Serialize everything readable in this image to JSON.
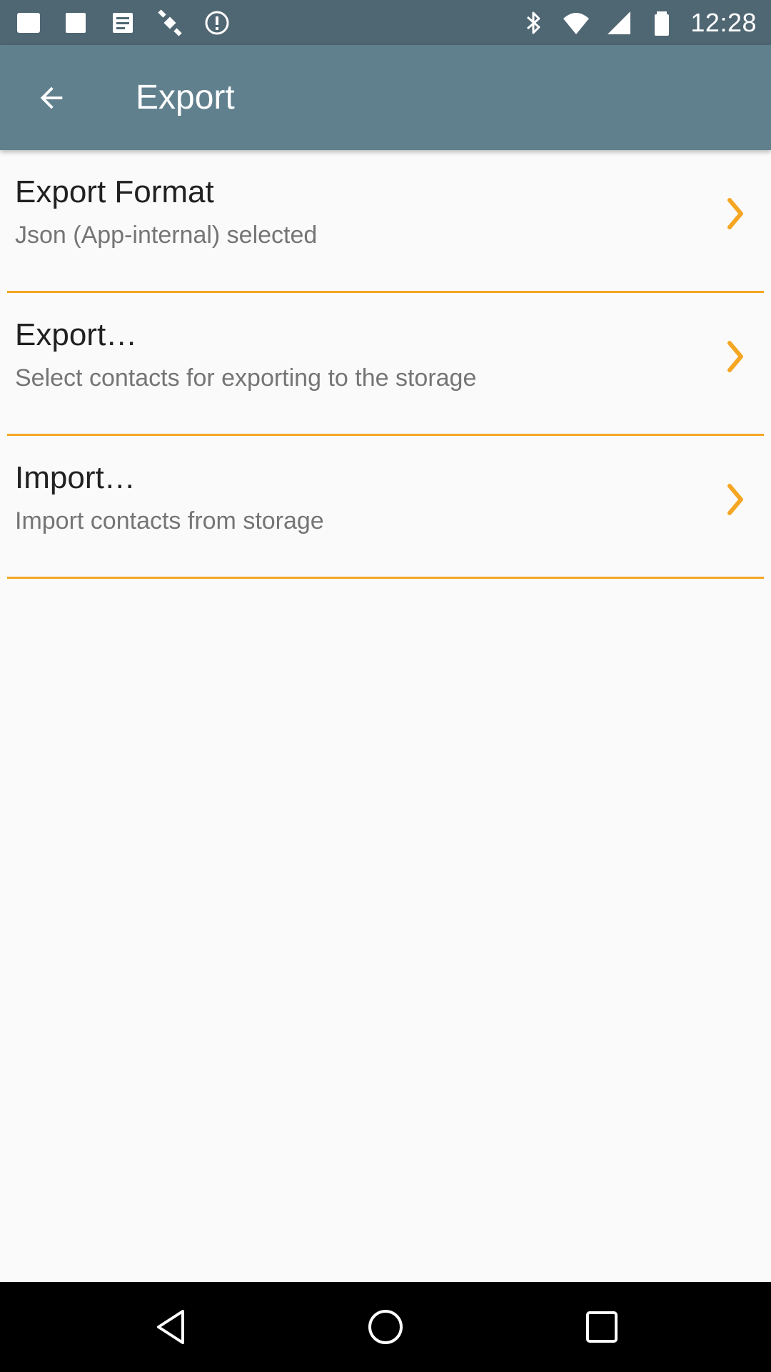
{
  "status_bar": {
    "time": "12:28",
    "left_icons": [
      "grid-icon",
      "tile-icon",
      "text-tile-icon",
      "satellite-icon",
      "alert-icon"
    ],
    "right_icons": [
      "bluetooth-icon",
      "wifi-icon",
      "signal-icon",
      "battery-icon"
    ]
  },
  "app_bar": {
    "title": "Export",
    "back_icon": "arrow-back-icon"
  },
  "preferences": [
    {
      "title": "Export Format",
      "summary": "Json (App-internal) selected"
    },
    {
      "title": "Export…",
      "summary": "Select contacts for exporting to the storage"
    },
    {
      "title": "Import…",
      "summary": "Import contacts from storage"
    }
  ],
  "nav_bar": {
    "back_icon": "nav-back-icon",
    "home_icon": "nav-home-icon",
    "recents_icon": "nav-recents-icon"
  },
  "colors": {
    "status_bar": "#4f6673",
    "app_bar": "#60808e",
    "accent": "#f5a623",
    "background": "#fafafa"
  }
}
